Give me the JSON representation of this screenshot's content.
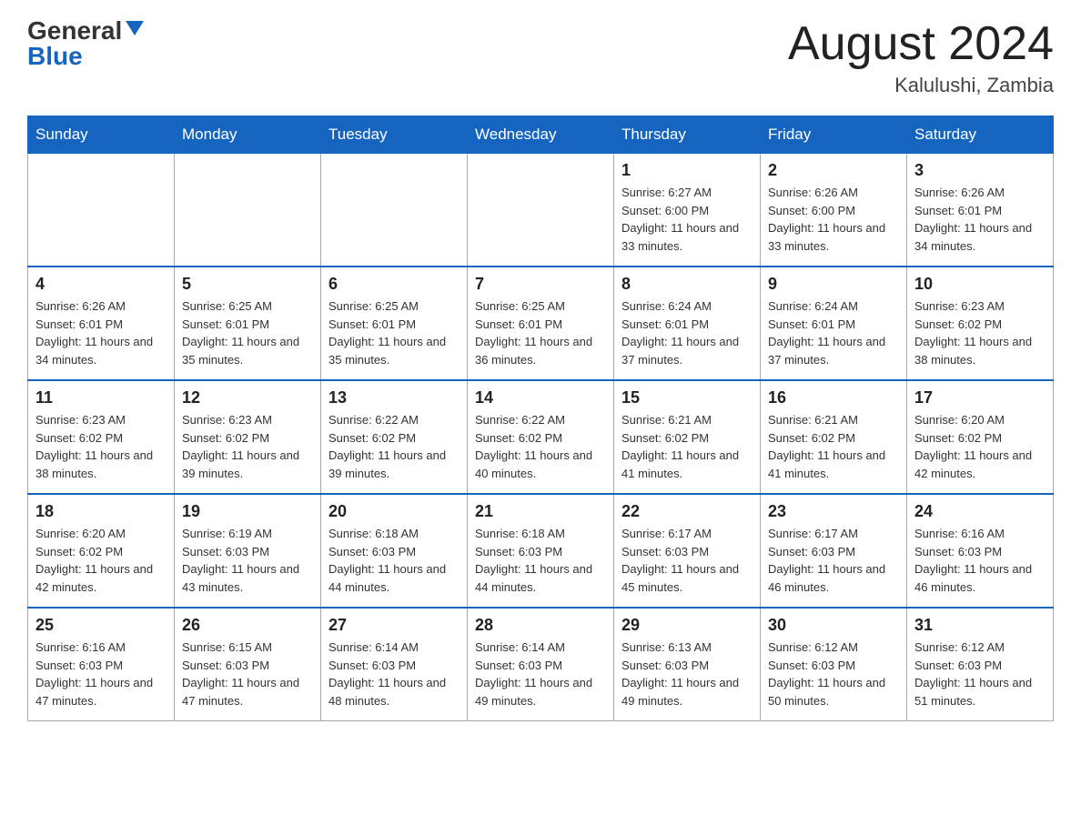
{
  "header": {
    "logo_general": "General",
    "logo_blue": "Blue",
    "month_title": "August 2024",
    "location": "Kalulushi, Zambia"
  },
  "days_of_week": [
    "Sunday",
    "Monday",
    "Tuesday",
    "Wednesday",
    "Thursday",
    "Friday",
    "Saturday"
  ],
  "weeks": [
    [
      {
        "day": "",
        "info": ""
      },
      {
        "day": "",
        "info": ""
      },
      {
        "day": "",
        "info": ""
      },
      {
        "day": "",
        "info": ""
      },
      {
        "day": "1",
        "info": "Sunrise: 6:27 AM\nSunset: 6:00 PM\nDaylight: 11 hours and 33 minutes."
      },
      {
        "day": "2",
        "info": "Sunrise: 6:26 AM\nSunset: 6:00 PM\nDaylight: 11 hours and 33 minutes."
      },
      {
        "day": "3",
        "info": "Sunrise: 6:26 AM\nSunset: 6:01 PM\nDaylight: 11 hours and 34 minutes."
      }
    ],
    [
      {
        "day": "4",
        "info": "Sunrise: 6:26 AM\nSunset: 6:01 PM\nDaylight: 11 hours and 34 minutes."
      },
      {
        "day": "5",
        "info": "Sunrise: 6:25 AM\nSunset: 6:01 PM\nDaylight: 11 hours and 35 minutes."
      },
      {
        "day": "6",
        "info": "Sunrise: 6:25 AM\nSunset: 6:01 PM\nDaylight: 11 hours and 35 minutes."
      },
      {
        "day": "7",
        "info": "Sunrise: 6:25 AM\nSunset: 6:01 PM\nDaylight: 11 hours and 36 minutes."
      },
      {
        "day": "8",
        "info": "Sunrise: 6:24 AM\nSunset: 6:01 PM\nDaylight: 11 hours and 37 minutes."
      },
      {
        "day": "9",
        "info": "Sunrise: 6:24 AM\nSunset: 6:01 PM\nDaylight: 11 hours and 37 minutes."
      },
      {
        "day": "10",
        "info": "Sunrise: 6:23 AM\nSunset: 6:02 PM\nDaylight: 11 hours and 38 minutes."
      }
    ],
    [
      {
        "day": "11",
        "info": "Sunrise: 6:23 AM\nSunset: 6:02 PM\nDaylight: 11 hours and 38 minutes."
      },
      {
        "day": "12",
        "info": "Sunrise: 6:23 AM\nSunset: 6:02 PM\nDaylight: 11 hours and 39 minutes."
      },
      {
        "day": "13",
        "info": "Sunrise: 6:22 AM\nSunset: 6:02 PM\nDaylight: 11 hours and 39 minutes."
      },
      {
        "day": "14",
        "info": "Sunrise: 6:22 AM\nSunset: 6:02 PM\nDaylight: 11 hours and 40 minutes."
      },
      {
        "day": "15",
        "info": "Sunrise: 6:21 AM\nSunset: 6:02 PM\nDaylight: 11 hours and 41 minutes."
      },
      {
        "day": "16",
        "info": "Sunrise: 6:21 AM\nSunset: 6:02 PM\nDaylight: 11 hours and 41 minutes."
      },
      {
        "day": "17",
        "info": "Sunrise: 6:20 AM\nSunset: 6:02 PM\nDaylight: 11 hours and 42 minutes."
      }
    ],
    [
      {
        "day": "18",
        "info": "Sunrise: 6:20 AM\nSunset: 6:02 PM\nDaylight: 11 hours and 42 minutes."
      },
      {
        "day": "19",
        "info": "Sunrise: 6:19 AM\nSunset: 6:03 PM\nDaylight: 11 hours and 43 minutes."
      },
      {
        "day": "20",
        "info": "Sunrise: 6:18 AM\nSunset: 6:03 PM\nDaylight: 11 hours and 44 minutes."
      },
      {
        "day": "21",
        "info": "Sunrise: 6:18 AM\nSunset: 6:03 PM\nDaylight: 11 hours and 44 minutes."
      },
      {
        "day": "22",
        "info": "Sunrise: 6:17 AM\nSunset: 6:03 PM\nDaylight: 11 hours and 45 minutes."
      },
      {
        "day": "23",
        "info": "Sunrise: 6:17 AM\nSunset: 6:03 PM\nDaylight: 11 hours and 46 minutes."
      },
      {
        "day": "24",
        "info": "Sunrise: 6:16 AM\nSunset: 6:03 PM\nDaylight: 11 hours and 46 minutes."
      }
    ],
    [
      {
        "day": "25",
        "info": "Sunrise: 6:16 AM\nSunset: 6:03 PM\nDaylight: 11 hours and 47 minutes."
      },
      {
        "day": "26",
        "info": "Sunrise: 6:15 AM\nSunset: 6:03 PM\nDaylight: 11 hours and 47 minutes."
      },
      {
        "day": "27",
        "info": "Sunrise: 6:14 AM\nSunset: 6:03 PM\nDaylight: 11 hours and 48 minutes."
      },
      {
        "day": "28",
        "info": "Sunrise: 6:14 AM\nSunset: 6:03 PM\nDaylight: 11 hours and 49 minutes."
      },
      {
        "day": "29",
        "info": "Sunrise: 6:13 AM\nSunset: 6:03 PM\nDaylight: 11 hours and 49 minutes."
      },
      {
        "day": "30",
        "info": "Sunrise: 6:12 AM\nSunset: 6:03 PM\nDaylight: 11 hours and 50 minutes."
      },
      {
        "day": "31",
        "info": "Sunrise: 6:12 AM\nSunset: 6:03 PM\nDaylight: 11 hours and 51 minutes."
      }
    ]
  ]
}
